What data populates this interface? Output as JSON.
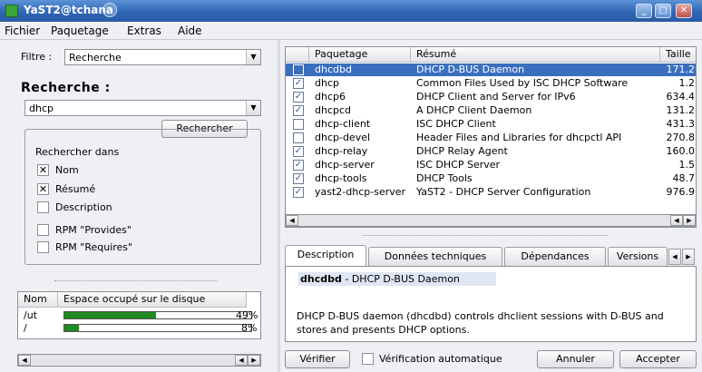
{
  "window": {
    "title": "YaST2@tchana"
  },
  "menu": {
    "fichier": "Fichier",
    "paquetage": "Paquetage",
    "extras": "Extras",
    "aide": "Aide"
  },
  "filter": {
    "label": "Filtre :",
    "value": "Recherche"
  },
  "search": {
    "heading": "Recherche :",
    "query": "dhcp",
    "button": "Rechercher",
    "in_label": "Rechercher dans",
    "options": [
      {
        "label": "Nom",
        "checked": true
      },
      {
        "label": "Résumé",
        "checked": true
      },
      {
        "label": "Description",
        "checked": false
      },
      {
        "label": "RPM \"Provides\"",
        "checked": false
      },
      {
        "label": "RPM \"Requires\"",
        "checked": false
      }
    ]
  },
  "disk": {
    "headers": [
      "Nom",
      "Espace occupé sur le disque"
    ],
    "rows": [
      {
        "name": "/ut",
        "percent": 49,
        "label": "49%"
      },
      {
        "name": "/",
        "percent": 8,
        "label": "8%"
      }
    ]
  },
  "packages": {
    "headers": [
      "Paquetage",
      "Résumé",
      "Taille"
    ],
    "rows": [
      {
        "name": "dhcdbd",
        "summary": "DHCP D-BUS Daemon",
        "size": "171.2",
        "checked": false,
        "selected": true
      },
      {
        "name": "dhcp",
        "summary": "Common Files Used by ISC DHCP Software",
        "size": "1.2",
        "checked": true,
        "selected": false
      },
      {
        "name": "dhcp6",
        "summary": "DHCP Client and Server for IPv6",
        "size": "634.4",
        "checked": true,
        "selected": false
      },
      {
        "name": "dhcpcd",
        "summary": "A DHCP Client Daemon",
        "size": "131.2",
        "checked": true,
        "selected": false
      },
      {
        "name": "dhcp-client",
        "summary": "ISC DHCP Client",
        "size": "431.3",
        "checked": false,
        "selected": false
      },
      {
        "name": "dhcp-devel",
        "summary": "Header Files and Libraries for dhcpctl API",
        "size": "270.8",
        "checked": false,
        "selected": false
      },
      {
        "name": "dhcp-relay",
        "summary": "DHCP Relay Agent",
        "size": "160.0",
        "checked": true,
        "selected": false
      },
      {
        "name": "dhcp-server",
        "summary": "ISC DHCP Server",
        "size": "1.5",
        "checked": true,
        "selected": false
      },
      {
        "name": "dhcp-tools",
        "summary": "DHCP Tools",
        "size": "48.7",
        "checked": true,
        "selected": false
      },
      {
        "name": "yast2-dhcp-server",
        "summary": "YaST2 - DHCP Server Configuration",
        "size": "976.9",
        "checked": true,
        "selected": false
      }
    ]
  },
  "tabs": [
    "Description",
    "Données techniques",
    "Dépendances",
    "Versions"
  ],
  "description": {
    "title_name": "dhcdbd",
    "title_rest": " - DHCP D-BUS Daemon",
    "body": "DHCP D-BUS daemon (dhcdbd) controls dhclient sessions with D-BUS and stores and presents DHCP options."
  },
  "footer": {
    "verify": "Vérifier",
    "auto_verify": "Vérification automatique",
    "cancel": "Annuler",
    "accept": "Accepter"
  }
}
